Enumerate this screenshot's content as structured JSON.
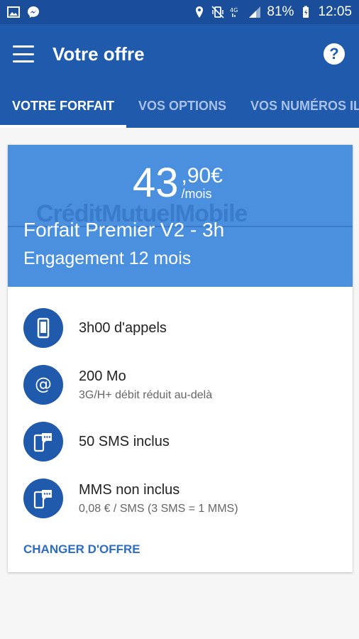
{
  "statusbar": {
    "battery": "81%",
    "time": "12:05"
  },
  "appbar": {
    "title": "Votre offre"
  },
  "tabs": [
    {
      "label": "VOTRE FORFAIT"
    },
    {
      "label": "VOS OPTIONS"
    },
    {
      "label": "VOS NUMÉROS IL"
    }
  ],
  "offer": {
    "price_main": "43",
    "price_cents": ",90€",
    "price_unit": "/mois",
    "watermark": "CréditMutuelMobile",
    "name": "Forfait Premier V2 - 3h",
    "engagement": "Engagement 12 mois"
  },
  "features": [
    {
      "icon": "phone-icon",
      "main": "3h00 d'appels",
      "sub": ""
    },
    {
      "icon": "at-icon",
      "main": "200 Mo",
      "sub": "3G/H+ débit réduit au-delà"
    },
    {
      "icon": "sms-icon",
      "main": "50 SMS inclus",
      "sub": ""
    },
    {
      "icon": "mms-icon",
      "main": "MMS non inclus",
      "sub": "0,08 € / SMS (3 SMS = 1 MMS)"
    }
  ],
  "actions": {
    "change_offer": "CHANGER D'OFFRE"
  },
  "colors": {
    "primary": "#1f5aad",
    "hero": "#4a90de",
    "accent": "#2b6cc4"
  }
}
